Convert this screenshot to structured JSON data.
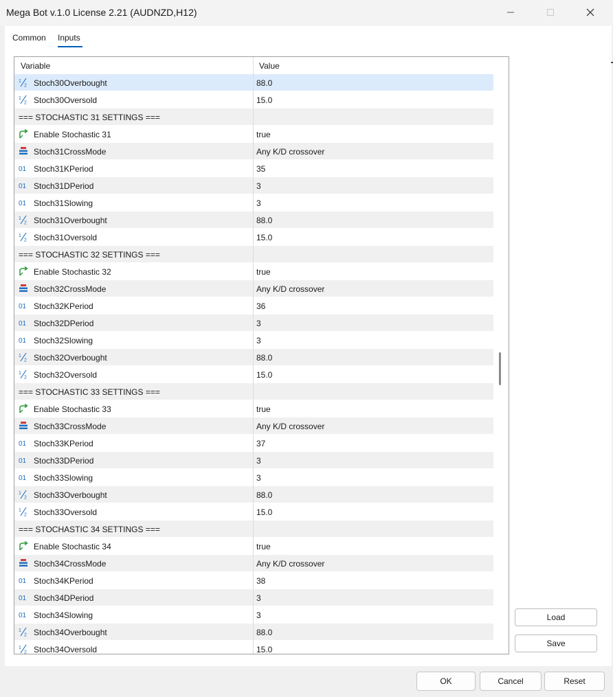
{
  "window": {
    "title": "Mega Bot v.1.0 License 2.21 (AUDNZD,H12)"
  },
  "tabs": [
    {
      "label": "Common",
      "active": false
    },
    {
      "label": "Inputs",
      "active": true
    }
  ],
  "grid": {
    "columns": [
      "Variable",
      "Value"
    ],
    "rows": [
      {
        "icon": "fraction-icon",
        "name": "Stoch30Overbought",
        "value": "88.0",
        "selected": true
      },
      {
        "icon": "fraction-icon",
        "name": "Stoch30Oversold",
        "value": "15.0"
      },
      {
        "icon": "",
        "name": "=== STOCHASTIC 31 SETTINGS ===",
        "value": "",
        "section": true
      },
      {
        "icon": "toggle-arrow-icon",
        "name": "Enable Stochastic 31",
        "value": "true"
      },
      {
        "icon": "enum-list-icon",
        "name": "Stoch31CrossMode",
        "value": "Any K/D crossover"
      },
      {
        "icon": "integer-icon",
        "name": "Stoch31KPeriod",
        "value": "35"
      },
      {
        "icon": "integer-icon",
        "name": "Stoch31DPeriod",
        "value": "3"
      },
      {
        "icon": "integer-icon",
        "name": "Stoch31Slowing",
        "value": "3"
      },
      {
        "icon": "fraction-icon",
        "name": "Stoch31Overbought",
        "value": "88.0"
      },
      {
        "icon": "fraction-icon",
        "name": "Stoch31Oversold",
        "value": "15.0"
      },
      {
        "icon": "",
        "name": "=== STOCHASTIC 32 SETTINGS ===",
        "value": "",
        "section": true
      },
      {
        "icon": "toggle-arrow-icon",
        "name": "Enable Stochastic 32",
        "value": "true"
      },
      {
        "icon": "enum-list-icon",
        "name": "Stoch32CrossMode",
        "value": "Any K/D crossover"
      },
      {
        "icon": "integer-icon",
        "name": "Stoch32KPeriod",
        "value": "36"
      },
      {
        "icon": "integer-icon",
        "name": "Stoch32DPeriod",
        "value": "3"
      },
      {
        "icon": "integer-icon",
        "name": "Stoch32Slowing",
        "value": "3"
      },
      {
        "icon": "fraction-icon",
        "name": "Stoch32Overbought",
        "value": "88.0"
      },
      {
        "icon": "fraction-icon",
        "name": "Stoch32Oversold",
        "value": "15.0"
      },
      {
        "icon": "",
        "name": "=== STOCHASTIC 33 SETTINGS ===",
        "value": "",
        "section": true
      },
      {
        "icon": "toggle-arrow-icon",
        "name": "Enable Stochastic 33",
        "value": "true"
      },
      {
        "icon": "enum-list-icon",
        "name": "Stoch33CrossMode",
        "value": "Any K/D crossover"
      },
      {
        "icon": "integer-icon",
        "name": "Stoch33KPeriod",
        "value": "37"
      },
      {
        "icon": "integer-icon",
        "name": "Stoch33DPeriod",
        "value": "3"
      },
      {
        "icon": "integer-icon",
        "name": "Stoch33Slowing",
        "value": "3"
      },
      {
        "icon": "fraction-icon",
        "name": "Stoch33Overbought",
        "value": "88.0"
      },
      {
        "icon": "fraction-icon",
        "name": "Stoch33Oversold",
        "value": "15.0"
      },
      {
        "icon": "",
        "name": "=== STOCHASTIC 34 SETTINGS ===",
        "value": "",
        "section": true
      },
      {
        "icon": "toggle-arrow-icon",
        "name": "Enable Stochastic 34",
        "value": "true"
      },
      {
        "icon": "enum-list-icon",
        "name": "Stoch34CrossMode",
        "value": "Any K/D crossover"
      },
      {
        "icon": "integer-icon",
        "name": "Stoch34KPeriod",
        "value": "38"
      },
      {
        "icon": "integer-icon",
        "name": "Stoch34DPeriod",
        "value": "3"
      },
      {
        "icon": "integer-icon",
        "name": "Stoch34Slowing",
        "value": "3"
      },
      {
        "icon": "fraction-icon",
        "name": "Stoch34Overbought",
        "value": "88.0"
      },
      {
        "icon": "fraction-icon",
        "name": "Stoch34Oversold",
        "value": "15.0"
      }
    ]
  },
  "side_buttons": {
    "load": "Load",
    "save": "Save"
  },
  "footer": {
    "ok": "OK",
    "cancel": "Cancel",
    "reset": "Reset"
  },
  "colors": {
    "accent": "#005fb8",
    "selected_row": "#dcebfc",
    "alt_row": "#f0f0f0",
    "icon_blue": "#1e6fbf",
    "icon_green": "#2e9a3e",
    "icon_red": "#d23a3a"
  }
}
